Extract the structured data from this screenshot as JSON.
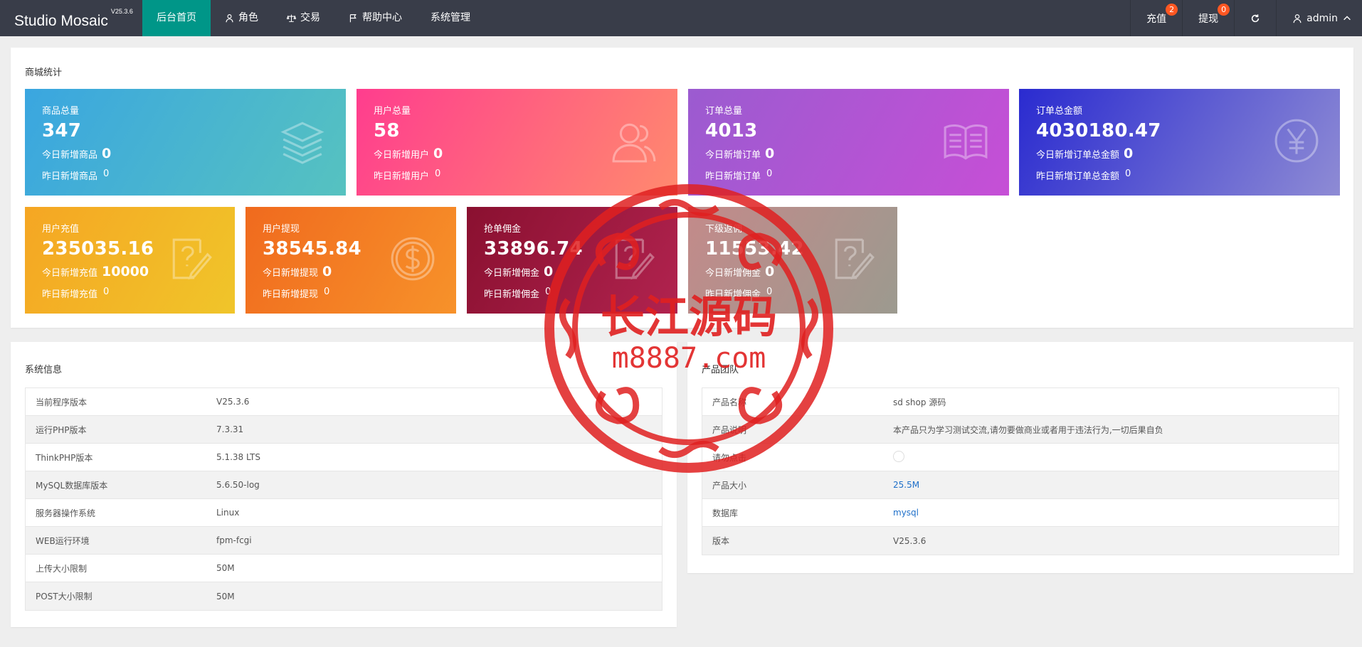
{
  "app": {
    "name": "Studio Mosaic",
    "version": "V25.3.6"
  },
  "nav": [
    {
      "label": "后台首页",
      "icon": "home",
      "active": true
    },
    {
      "label": "角色",
      "icon": "user-icon",
      "active": false
    },
    {
      "label": "交易",
      "icon": "scale-icon",
      "active": false
    },
    {
      "label": "帮助中心",
      "icon": "flag-icon",
      "active": false
    },
    {
      "label": "系统管理",
      "icon": "",
      "active": false
    }
  ],
  "right_nav": {
    "recharge": {
      "label": "充值",
      "badge": "2"
    },
    "withdraw": {
      "label": "提现",
      "badge": "0"
    },
    "refresh_icon": "refresh-icon",
    "user": {
      "label": "admin",
      "icon": "user-icon"
    }
  },
  "stats": {
    "title": "商城统计",
    "tiles": [
      {
        "label": "商品总量",
        "value": "347",
        "today_label": "今日新增商品",
        "today_value": "0",
        "yest_label": "昨日新增商品",
        "yest_value": "0",
        "icon": "stack-icon",
        "gradient": [
          "#3aa6e0",
          "#56c2c0"
        ]
      },
      {
        "label": "用户总量",
        "value": "58",
        "today_label": "今日新增用户",
        "today_value": "0",
        "yest_label": "昨日新增用户",
        "yest_value": "0",
        "icon": "users-icon",
        "gradient": [
          "#ff3d8e",
          "#ff8a6e"
        ]
      },
      {
        "label": "订单总量",
        "value": "4013",
        "today_label": "今日新增订单",
        "today_value": "0",
        "yest_label": "昨日新增订单",
        "yest_value": "0",
        "icon": "book-icon",
        "gradient": [
          "#9b5bd0",
          "#c64fd6"
        ]
      },
      {
        "label": "订单总金额",
        "value": "4030180.47",
        "today_label": "今日新增订单总金额",
        "today_value": "0",
        "yest_label": "昨日新增订单总金额",
        "yest_value": "0",
        "icon": "yen-icon",
        "gradient": [
          "#2a2bd0",
          "#8e8bd4"
        ]
      },
      {
        "label": "用户充值",
        "value": "235035.16",
        "today_label": "今日新增充值",
        "today_value": "10000",
        "yest_label": "昨日新增充值",
        "yest_value": "0",
        "icon": "question-note-icon",
        "gradient": [
          "#f5a623",
          "#f0c52a"
        ]
      },
      {
        "label": "用户提现",
        "value": "38545.84",
        "today_label": "今日新增提现",
        "today_value": "0",
        "yest_label": "昨日新增提现",
        "yest_value": "0",
        "icon": "dollar-icon",
        "gradient": [
          "#f06a1e",
          "#f7922a"
        ]
      },
      {
        "label": "抢单佣金",
        "value": "33896.74",
        "today_label": "今日新增佣金",
        "today_value": "0",
        "yest_label": "昨日新增佣金",
        "yest_value": "0",
        "icon": "question-note-icon",
        "gradient": [
          "#8a1030",
          "#b1234f"
        ]
      },
      {
        "label": "下级返佣",
        "value": "11553.42",
        "today_label": "今日新增佣金",
        "today_value": "0",
        "yest_label": "昨日新增佣金",
        "yest_value": "0",
        "icon": "question-note-icon",
        "gradient": [
          "#c38a8a",
          "#9c9a8f"
        ]
      }
    ]
  },
  "system_info": {
    "title": "系统信息",
    "rows": [
      {
        "k": "当前程序版本",
        "v": "V25.3.6"
      },
      {
        "k": "运行PHP版本",
        "v": "7.3.31"
      },
      {
        "k": "ThinkPHP版本",
        "v": "5.1.38 LTS"
      },
      {
        "k": "MySQL数据库版本",
        "v": "5.6.50-log"
      },
      {
        "k": "服务器操作系统",
        "v": "Linux"
      },
      {
        "k": "WEB运行环境",
        "v": "fpm-fcgi"
      },
      {
        "k": "上传大小限制",
        "v": "50M"
      },
      {
        "k": "POST大小限制",
        "v": "50M"
      }
    ]
  },
  "product_team": {
    "title": "产品团队",
    "rows": [
      {
        "k": "产品名称",
        "v": "sd shop 源码",
        "link": false
      },
      {
        "k": "产品说明",
        "v": "本产品只为学习测试交流,请勿要做商业或者用于违法行为,一切后果自负",
        "link": false
      },
      {
        "k": "请勿点击",
        "v": "",
        "link": false,
        "icon": "circle-icon"
      },
      {
        "k": "产品大小",
        "v": "25.5M",
        "link": true
      },
      {
        "k": "数据库",
        "v": "mysql",
        "link": true
      },
      {
        "k": "版本",
        "v": "V25.3.6",
        "link": false
      }
    ]
  },
  "watermark": {
    "line1": "长江源码",
    "line2": "m8887.com",
    "color": "#e02020"
  }
}
